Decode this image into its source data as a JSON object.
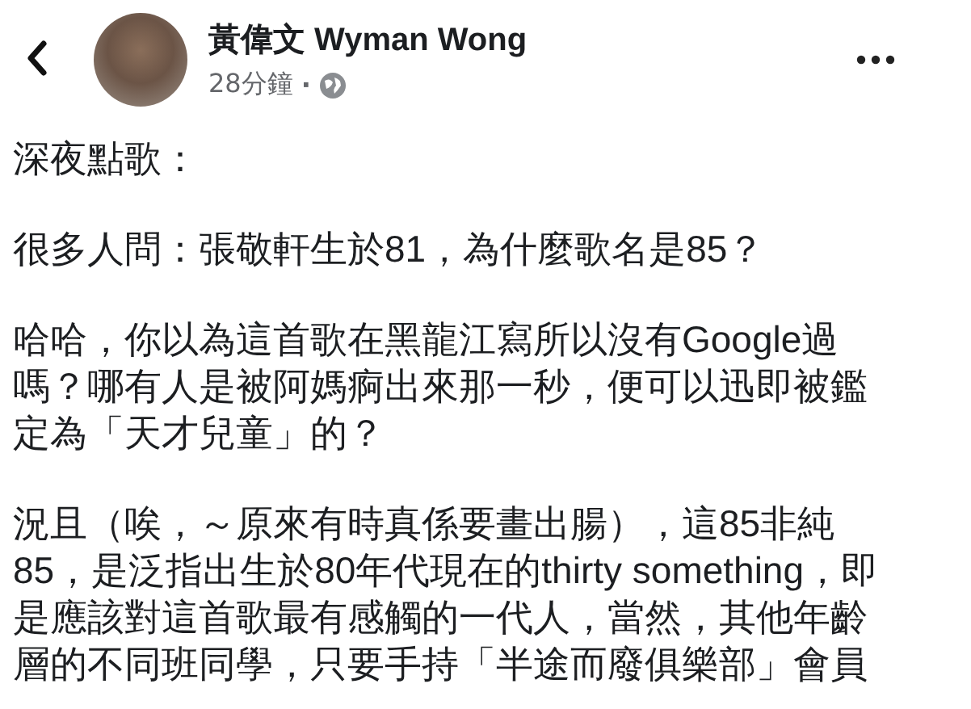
{
  "header": {
    "author": "黃偉文 Wyman Wong",
    "time": "28分鐘",
    "separator": "·"
  },
  "post": {
    "paragraphs": [
      [
        "深夜點歌："
      ],
      [
        "很多人問：張敬軒生於81，為什麼歌名是85？"
      ],
      [
        "哈哈，你以為這首歌在黑龍江寫所以沒有Google過",
        "嗎？哪有人是被阿媽痾出來那一秒，便可以迅即被鑑",
        "定為「天才兒童」的？"
      ],
      [
        "況且（唉，～原來有時真係要畫出腸），這85非純",
        "85，是泛指出生於80年代現在的thirty something，即",
        "是應該對這首歌最有感觸的一代人，當然，其他年齡",
        "層的不同班同學，只要手持「半途而廢俱樂部」會員"
      ]
    ]
  }
}
